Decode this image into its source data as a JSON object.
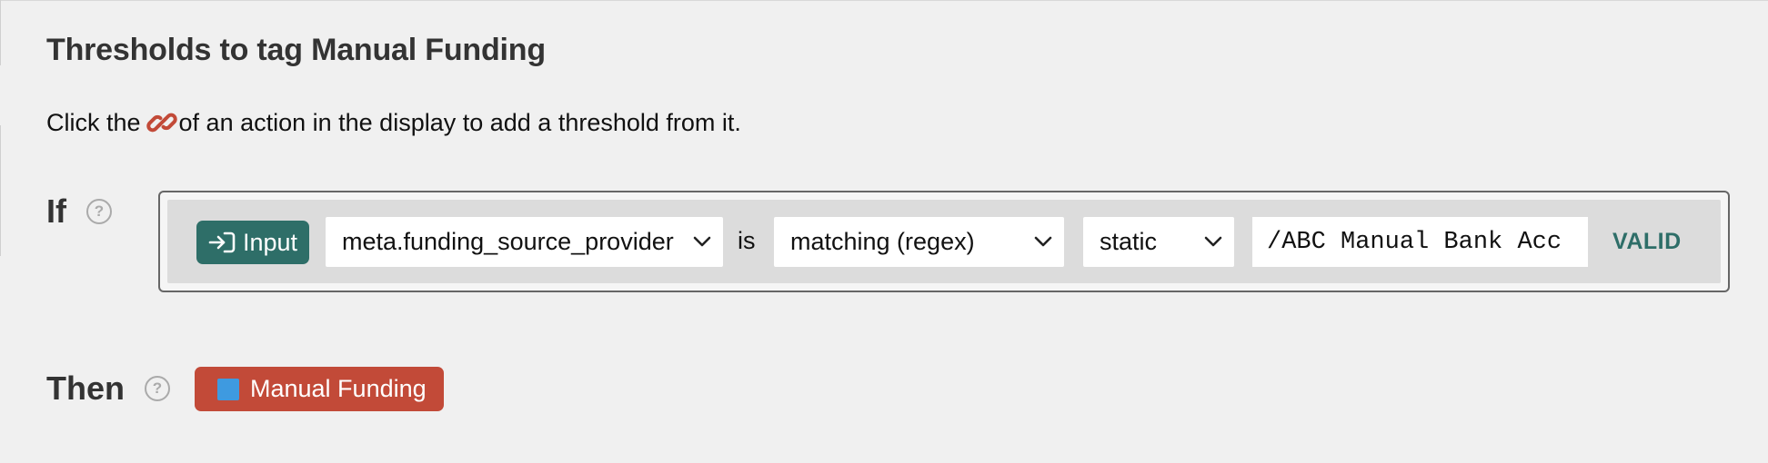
{
  "section": {
    "title": "Thresholds to tag Manual Funding",
    "hint_before": "Click the",
    "hint_after": "of an action in the display to add a threshold from it."
  },
  "if_row": {
    "label": "If",
    "help": "?",
    "source_label": "Input",
    "field_value": "meta.funding_source_provider",
    "is_text": "is",
    "operator_value": "matching (regex)",
    "mode_value": "static",
    "pattern_value": "/ABC Manual Bank Acc",
    "status": "VALID"
  },
  "then_row": {
    "label": "Then",
    "help": "?",
    "tag_label": "Manual Funding"
  },
  "colors": {
    "accent": "#2e6e68",
    "tag_bg": "#c24a38",
    "tag_swatch": "#3e9ae0",
    "link_icon": "#c24a38"
  },
  "icons": {
    "link": "link-icon",
    "input": "sign-in-icon",
    "help": "question-circle-icon",
    "dropdown": "chevron-down-icon"
  }
}
